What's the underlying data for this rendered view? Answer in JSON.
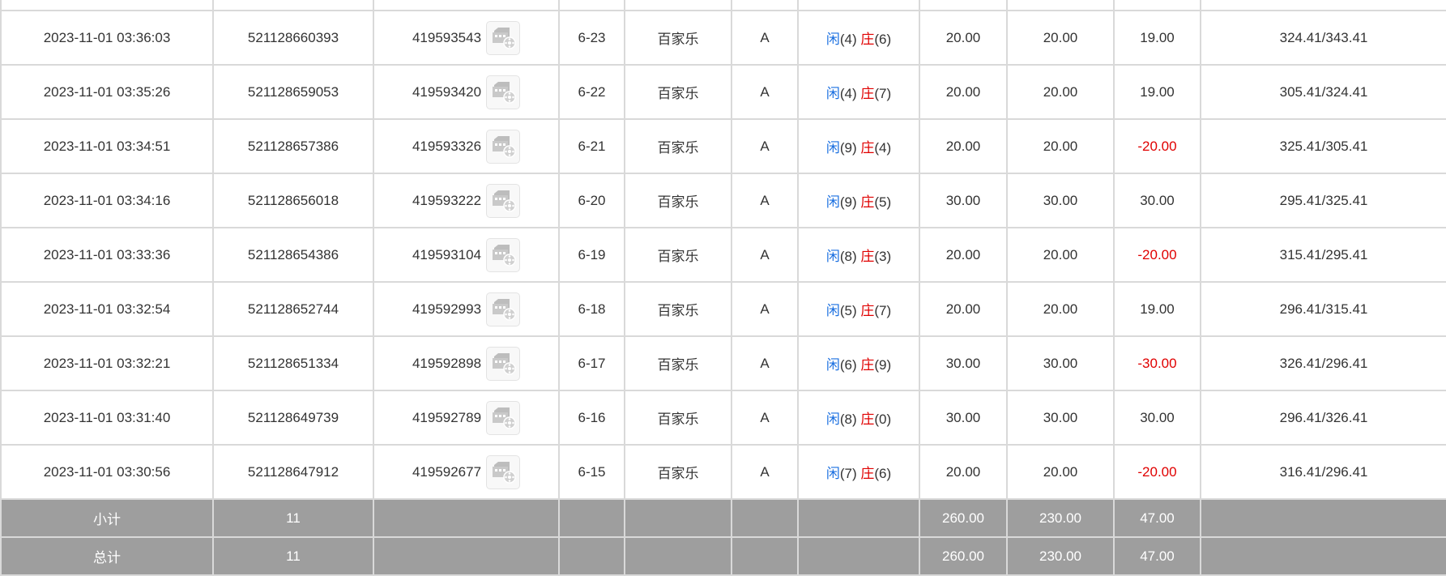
{
  "table": {
    "rows": [
      {
        "time": "2023-11-01 03:36:03",
        "order": "521128660393",
        "round": "419593543",
        "shoe": "6-23",
        "game": "百家乐",
        "table": "A",
        "player_label": "闲",
        "player_score": "(4)",
        "banker_label": "庄",
        "banker_score": "(6)",
        "bet": "20.00",
        "valid": "20.00",
        "win": "19.00",
        "win_sign": "pos",
        "balance": "324.41/343.41"
      },
      {
        "time": "2023-11-01 03:35:26",
        "order": "521128659053",
        "round": "419593420",
        "shoe": "6-22",
        "game": "百家乐",
        "table": "A",
        "player_label": "闲",
        "player_score": "(4)",
        "banker_label": "庄",
        "banker_score": "(7)",
        "bet": "20.00",
        "valid": "20.00",
        "win": "19.00",
        "win_sign": "pos",
        "balance": "305.41/324.41"
      },
      {
        "time": "2023-11-01 03:34:51",
        "order": "521128657386",
        "round": "419593326",
        "shoe": "6-21",
        "game": "百家乐",
        "table": "A",
        "player_label": "闲",
        "player_score": "(9)",
        "banker_label": "庄",
        "banker_score": "(4)",
        "bet": "20.00",
        "valid": "20.00",
        "win": "-20.00",
        "win_sign": "neg",
        "balance": "325.41/305.41"
      },
      {
        "time": "2023-11-01 03:34:16",
        "order": "521128656018",
        "round": "419593222",
        "shoe": "6-20",
        "game": "百家乐",
        "table": "A",
        "player_label": "闲",
        "player_score": "(9)",
        "banker_label": "庄",
        "banker_score": "(5)",
        "bet": "30.00",
        "valid": "30.00",
        "win": "30.00",
        "win_sign": "pos",
        "balance": "295.41/325.41"
      },
      {
        "time": "2023-11-01 03:33:36",
        "order": "521128654386",
        "round": "419593104",
        "shoe": "6-19",
        "game": "百家乐",
        "table": "A",
        "player_label": "闲",
        "player_score": "(8)",
        "banker_label": "庄",
        "banker_score": "(3)",
        "bet": "20.00",
        "valid": "20.00",
        "win": "-20.00",
        "win_sign": "neg",
        "balance": "315.41/295.41"
      },
      {
        "time": "2023-11-01 03:32:54",
        "order": "521128652744",
        "round": "419592993",
        "shoe": "6-18",
        "game": "百家乐",
        "table": "A",
        "player_label": "闲",
        "player_score": "(5)",
        "banker_label": "庄",
        "banker_score": "(7)",
        "bet": "20.00",
        "valid": "20.00",
        "win": "19.00",
        "win_sign": "pos",
        "balance": "296.41/315.41"
      },
      {
        "time": "2023-11-01 03:32:21",
        "order": "521128651334",
        "round": "419592898",
        "shoe": "6-17",
        "game": "百家乐",
        "table": "A",
        "player_label": "闲",
        "player_score": "(6)",
        "banker_label": "庄",
        "banker_score": "(9)",
        "bet": "30.00",
        "valid": "30.00",
        "win": "-30.00",
        "win_sign": "neg",
        "balance": "326.41/296.41"
      },
      {
        "time": "2023-11-01 03:31:40",
        "order": "521128649739",
        "round": "419592789",
        "shoe": "6-16",
        "game": "百家乐",
        "table": "A",
        "player_label": "闲",
        "player_score": "(8)",
        "banker_label": "庄",
        "banker_score": "(0)",
        "bet": "30.00",
        "valid": "30.00",
        "win": "30.00",
        "win_sign": "pos",
        "balance": "296.41/326.41"
      },
      {
        "time": "2023-11-01 03:30:56",
        "order": "521128647912",
        "round": "419592677",
        "shoe": "6-15",
        "game": "百家乐",
        "table": "A",
        "player_label": "闲",
        "player_score": "(7)",
        "banker_label": "庄",
        "banker_score": "(6)",
        "bet": "20.00",
        "valid": "20.00",
        "win": "-20.00",
        "win_sign": "neg",
        "balance": "316.41/296.41"
      }
    ],
    "subtotal": {
      "label": "小计",
      "count": "11",
      "bet": "260.00",
      "valid": "230.00",
      "win": "47.00"
    },
    "total": {
      "label": "总计",
      "count": "11",
      "bet": "260.00",
      "valid": "230.00",
      "win": "47.00"
    }
  },
  "icons": {
    "replay": "video-replay-icon"
  },
  "colors": {
    "player": "#1a6fe0",
    "banker": "#e00000",
    "negative": "#e00000",
    "bet": "#1a6fe0",
    "summary_bg": "#9e9e9e",
    "border": "#d9d9d9"
  }
}
